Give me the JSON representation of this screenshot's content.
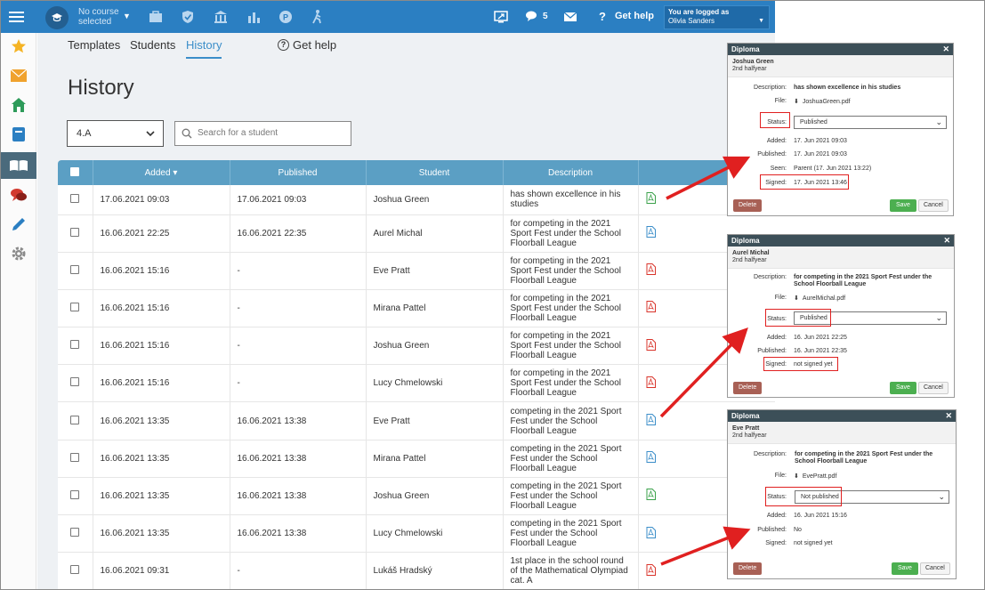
{
  "topbar": {
    "course_line1": "No course",
    "course_line2": "selected",
    "messages_count": "5",
    "help_label": "Get help",
    "user_line1": "You are logged as",
    "user_line2": "Olivia Sanders"
  },
  "tabs": [
    {
      "label": "Templates"
    },
    {
      "label": "Students"
    },
    {
      "label": "History"
    },
    {
      "label": "Get help"
    }
  ],
  "page_title": "History",
  "filter": {
    "class_value": "4.A",
    "search_placeholder": "Search for a student"
  },
  "table": {
    "headers": [
      "Added ▾",
      "Published",
      "Student",
      "Description"
    ],
    "rows": [
      {
        "added": "17.06.2021 09:03",
        "published": "17.06.2021 09:03",
        "student": "Joshua Green",
        "description": "has shown excellence in his studies",
        "file": "green"
      },
      {
        "added": "16.06.2021 22:25",
        "published": "16.06.2021 22:35",
        "student": "Aurel Michal",
        "description": "for competing in the 2021 Sport Fest under the School Floorball League",
        "file": "blue"
      },
      {
        "added": "16.06.2021 15:16",
        "published": "-",
        "student": "Eve Pratt",
        "description": "for competing in the 2021 Sport Fest under the School Floorball League",
        "file": "red"
      },
      {
        "added": "16.06.2021 15:16",
        "published": "-",
        "student": "Mirana Pattel",
        "description": "for competing in the 2021 Sport Fest under the School Floorball League",
        "file": "red"
      },
      {
        "added": "16.06.2021 15:16",
        "published": "-",
        "student": "Joshua Green",
        "description": "for competing in the 2021 Sport Fest under the School Floorball League",
        "file": "red"
      },
      {
        "added": "16.06.2021 15:16",
        "published": "-",
        "student": "Lucy Chmelowski",
        "description": "for competing in the 2021 Sport Fest under the School Floorball League",
        "file": "red"
      },
      {
        "added": "16.06.2021 13:35",
        "published": "16.06.2021 13:38",
        "student": "Eve Pratt",
        "description": "competing in the 2021 Sport Fest under the School Floorball League",
        "file": "blue"
      },
      {
        "added": "16.06.2021 13:35",
        "published": "16.06.2021 13:38",
        "student": "Mirana Pattel",
        "description": "competing in the 2021 Sport Fest under the School Floorball League",
        "file": "blue"
      },
      {
        "added": "16.06.2021 13:35",
        "published": "16.06.2021 13:38",
        "student": "Joshua Green",
        "description": "competing in the 2021 Sport Fest under the School Floorball League",
        "file": "green"
      },
      {
        "added": "16.06.2021 13:35",
        "published": "16.06.2021 13:38",
        "student": "Lucy Chmelowski",
        "description": "competing in the 2021 Sport Fest under the School Floorball League",
        "file": "blue"
      },
      {
        "added": "16.06.2021 09:31",
        "published": "-",
        "student": "Lukáš Hradský",
        "description": "1st place in the school round of the Mathematical Olympiad cat. A",
        "file": "red"
      }
    ]
  },
  "dialogs": [
    {
      "title": "Diploma",
      "student": "Joshua Green",
      "term": "2nd halfyear",
      "description_label": "Description:",
      "description": "has shown excellence in his studies",
      "file_label": "File:",
      "file": "JoshuaGreen.pdf",
      "status_label": "Status:",
      "status": "Published",
      "added_label": "Added:",
      "added": "17. Jun 2021 09:03",
      "published_label": "Published:",
      "published": "17. Jun 2021 09:03",
      "seen_label": "Seen:",
      "seen": "Parent (17. Jun 2021 13:22)",
      "signed_label": "Signed:",
      "signed": "17. Jun 2021 13:46",
      "delete_label": "Delete",
      "save_label": "Save",
      "cancel_label": "Cancel"
    },
    {
      "title": "Diploma",
      "student": "Aurel Michal",
      "term": "2nd halfyear",
      "description_label": "Description:",
      "description": "for competing in the 2021 Sport Fest under the School Floorball League",
      "file_label": "File:",
      "file": "AurelMichal.pdf",
      "status_label": "Status:",
      "status": "Published",
      "added_label": "Added:",
      "added": "16. Jun 2021 22:25",
      "published_label": "Published:",
      "published": "16. Jun 2021 22:35",
      "signed_label": "Signed:",
      "signed": "not signed yet",
      "delete_label": "Delete",
      "save_label": "Save",
      "cancel_label": "Cancel"
    },
    {
      "title": "Diploma",
      "student": "Eve Pratt",
      "term": "2nd halfyear",
      "description_label": "Description:",
      "description": "for competing in the 2021 Sport Fest under the School Floorball League",
      "file_label": "File:",
      "file": "EvePratt.pdf",
      "status_label": "Status:",
      "status": "Not published",
      "added_label": "Added:",
      "added": "16. Jun 2021 15:16",
      "published_label": "Published:",
      "published": "No",
      "signed_label": "Signed:",
      "signed": "not signed yet",
      "delete_label": "Delete",
      "save_label": "Save",
      "cancel_label": "Cancel"
    }
  ],
  "colors": {
    "topbar": "#2b7fc2",
    "table_header": "#5b9fc4",
    "accent": "#3b8ec9",
    "annotation": "#e02020",
    "file_green": "#3aa14a",
    "file_blue": "#3b8ec9",
    "file_red": "#d9342b"
  }
}
